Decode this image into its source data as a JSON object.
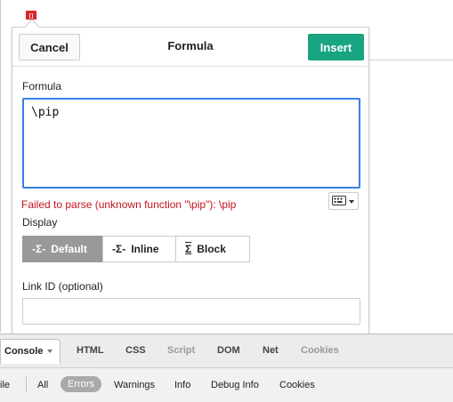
{
  "dialog": {
    "cancel_label": "Cancel",
    "title": "Formula",
    "insert_label": "Insert",
    "formula_label": "Formula",
    "formula_value": "\\pip",
    "error_text": "Failed to parse (unknown function \"\\pip\"): \\pip",
    "keyboard_icon": "keyboard-icon",
    "display_label": "Display",
    "display_options": [
      {
        "icon": "-Σ-",
        "label": "Default",
        "selected": true
      },
      {
        "icon": "-Σ-",
        "label": "Inline",
        "selected": false
      },
      {
        "icon": "Σ",
        "label": "Block",
        "selected": false
      }
    ],
    "link_id_label": "Link ID (optional)",
    "link_id_value": ""
  },
  "devtools": {
    "tabs": [
      "Console",
      "HTML",
      "CSS",
      "Script",
      "DOM",
      "Net",
      "Cookies"
    ],
    "filter_truncated": "ile",
    "filters": [
      "All",
      "Errors",
      "Warnings",
      "Info",
      "Debug Info",
      "Cookies"
    ],
    "selected_filter": "Errors"
  },
  "colors": {
    "insert_button": "#19a482",
    "focus_border": "#3a7ee7",
    "error_text": "#c2141c",
    "anchor_icon": "#d8232a"
  }
}
